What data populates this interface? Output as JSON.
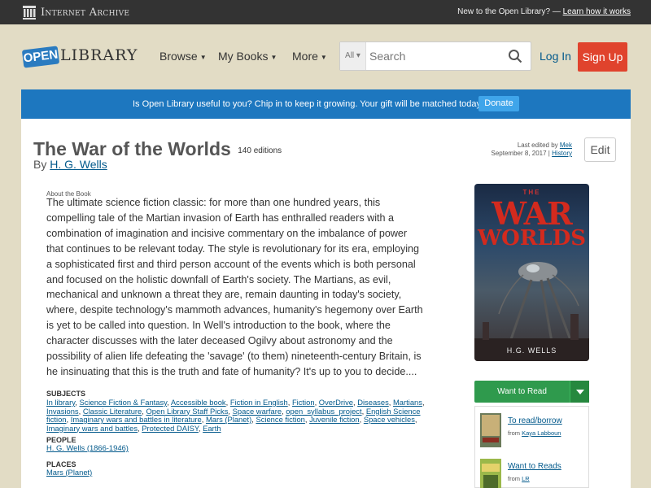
{
  "topbar": {
    "brand": "Internet Archive",
    "promo_text": "New to the Open Library? —",
    "promo_link": "Learn how it works"
  },
  "header": {
    "logo_open": "OPEN",
    "logo_library": "LIBRARY",
    "nav": [
      {
        "label": "Browse"
      },
      {
        "label": "My Books"
      },
      {
        "label": "More"
      }
    ],
    "search": {
      "scope": "All",
      "placeholder": "Search"
    },
    "login": "Log In",
    "signup": "Sign Up"
  },
  "donate": {
    "text": "Is Open Library useful to you? Chip in to keep it growing. Your gift will be matched today!",
    "button": "Donate"
  },
  "book": {
    "title": "The War of the Worlds",
    "editions": "140 editions",
    "by": "By",
    "author": "H. G. Wells",
    "last_edited_label": "Last edited by",
    "last_edited_user": "Mek",
    "last_edited_date": "September 8, 2017 |",
    "history_link": "History",
    "edit_button": "Edit",
    "about_label": "About the Book",
    "description": "The ultimate science fiction classic: for more than one hundred years, this compelling tale of the Martian invasion of Earth has enthralled readers with a combination of imagination and incisive commentary on the imbalance of power that continues to be relevant today. The style is revolutionary for its era, employing a sophisticated first and third person account of the events which is both personal and focused on the holistic downfall of Earth's society. The Martians, as evil, mechanical and unknown a threat they are, remain daunting in today's society, where, despite technology's mammoth advances, humanity's hegemony over Earth is yet to be called into question. In Well's introduction to the book, where the character discusses with the later deceased Ogilvy about astronomy and the possibility of alien life defeating the 'savage' (to them) nineteenth-century Britain, is he insinuating that this is the truth and fate of humanity? It's up to you to decide...."
  },
  "subjects": {
    "label": "SUBJECTS",
    "items": [
      "In library",
      "Science Fiction & Fantasy",
      "Accessible book",
      "Fiction in English",
      "Fiction",
      "OverDrive",
      "Diseases",
      "Martians",
      "Invasions",
      "Classic Literature",
      "Open Library Staff Picks",
      "Space warfare",
      "open_syllabus_project",
      "English Science fiction",
      "Imaginary wars and battles in literature",
      "Mars (Planet)",
      "Science fiction",
      "Juvenile fiction",
      "Space vehicles",
      "Imaginary wars and battles",
      "Protected DAISY",
      "Earth"
    ]
  },
  "people": {
    "label": "PEOPLE",
    "items": [
      "H. G. Wells (1866-1946)"
    ]
  },
  "places": {
    "label": "PLACES",
    "items": [
      "Mars (Planet)"
    ]
  },
  "cover": {
    "the": "THE",
    "war": "WAR",
    "worlds": "WORLDS",
    "author": "H.G. WELLS"
  },
  "want_to_read": {
    "label": "Want to Read"
  },
  "lists": [
    {
      "title": "To read/borrow",
      "from_label": "from",
      "from_user": "Kaya Labboun"
    },
    {
      "title": "Want to Reads",
      "from_label": "from",
      "from_user": "LR"
    }
  ],
  "colors": {
    "accent_blue": "#1d77bf",
    "signup_red": "#e0432d",
    "want_green": "#2f9a4d",
    "page_bg": "#e2dcc5"
  }
}
